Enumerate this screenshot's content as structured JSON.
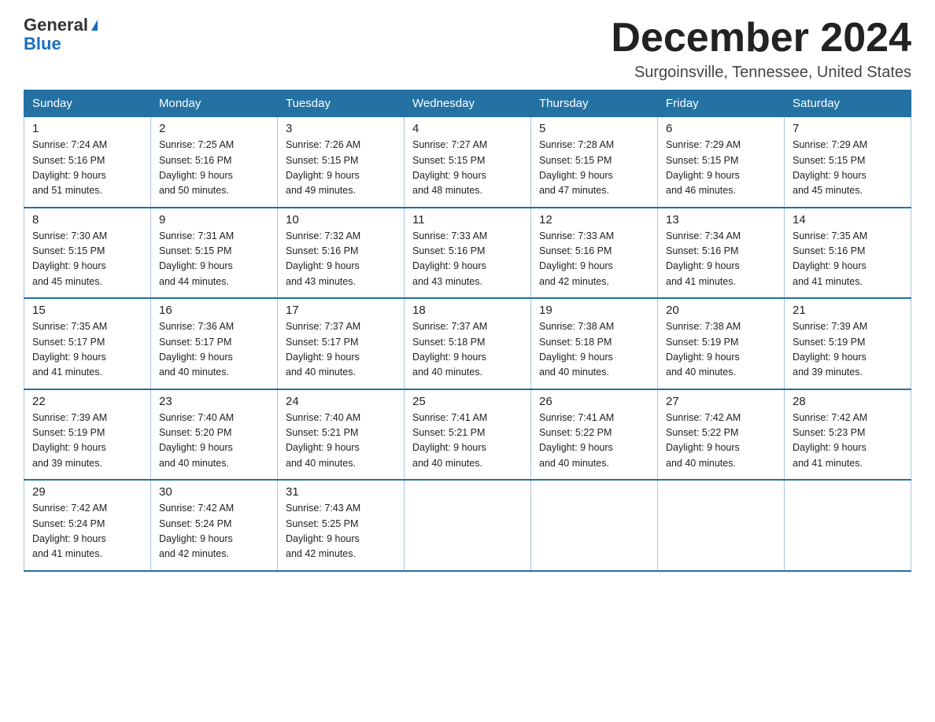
{
  "header": {
    "logo_general": "General",
    "logo_blue": "Blue",
    "month": "December 2024",
    "location": "Surgoinsville, Tennessee, United States"
  },
  "days_of_week": [
    "Sunday",
    "Monday",
    "Tuesday",
    "Wednesday",
    "Thursday",
    "Friday",
    "Saturday"
  ],
  "weeks": [
    [
      {
        "day": "1",
        "sunrise": "7:24 AM",
        "sunset": "5:16 PM",
        "daylight": "9 hours and 51 minutes."
      },
      {
        "day": "2",
        "sunrise": "7:25 AM",
        "sunset": "5:16 PM",
        "daylight": "9 hours and 50 minutes."
      },
      {
        "day": "3",
        "sunrise": "7:26 AM",
        "sunset": "5:15 PM",
        "daylight": "9 hours and 49 minutes."
      },
      {
        "day": "4",
        "sunrise": "7:27 AM",
        "sunset": "5:15 PM",
        "daylight": "9 hours and 48 minutes."
      },
      {
        "day": "5",
        "sunrise": "7:28 AM",
        "sunset": "5:15 PM",
        "daylight": "9 hours and 47 minutes."
      },
      {
        "day": "6",
        "sunrise": "7:29 AM",
        "sunset": "5:15 PM",
        "daylight": "9 hours and 46 minutes."
      },
      {
        "day": "7",
        "sunrise": "7:29 AM",
        "sunset": "5:15 PM",
        "daylight": "9 hours and 45 minutes."
      }
    ],
    [
      {
        "day": "8",
        "sunrise": "7:30 AM",
        "sunset": "5:15 PM",
        "daylight": "9 hours and 45 minutes."
      },
      {
        "day": "9",
        "sunrise": "7:31 AM",
        "sunset": "5:15 PM",
        "daylight": "9 hours and 44 minutes."
      },
      {
        "day": "10",
        "sunrise": "7:32 AM",
        "sunset": "5:16 PM",
        "daylight": "9 hours and 43 minutes."
      },
      {
        "day": "11",
        "sunrise": "7:33 AM",
        "sunset": "5:16 PM",
        "daylight": "9 hours and 43 minutes."
      },
      {
        "day": "12",
        "sunrise": "7:33 AM",
        "sunset": "5:16 PM",
        "daylight": "9 hours and 42 minutes."
      },
      {
        "day": "13",
        "sunrise": "7:34 AM",
        "sunset": "5:16 PM",
        "daylight": "9 hours and 41 minutes."
      },
      {
        "day": "14",
        "sunrise": "7:35 AM",
        "sunset": "5:16 PM",
        "daylight": "9 hours and 41 minutes."
      }
    ],
    [
      {
        "day": "15",
        "sunrise": "7:35 AM",
        "sunset": "5:17 PM",
        "daylight": "9 hours and 41 minutes."
      },
      {
        "day": "16",
        "sunrise": "7:36 AM",
        "sunset": "5:17 PM",
        "daylight": "9 hours and 40 minutes."
      },
      {
        "day": "17",
        "sunrise": "7:37 AM",
        "sunset": "5:17 PM",
        "daylight": "9 hours and 40 minutes."
      },
      {
        "day": "18",
        "sunrise": "7:37 AM",
        "sunset": "5:18 PM",
        "daylight": "9 hours and 40 minutes."
      },
      {
        "day": "19",
        "sunrise": "7:38 AM",
        "sunset": "5:18 PM",
        "daylight": "9 hours and 40 minutes."
      },
      {
        "day": "20",
        "sunrise": "7:38 AM",
        "sunset": "5:19 PM",
        "daylight": "9 hours and 40 minutes."
      },
      {
        "day": "21",
        "sunrise": "7:39 AM",
        "sunset": "5:19 PM",
        "daylight": "9 hours and 39 minutes."
      }
    ],
    [
      {
        "day": "22",
        "sunrise": "7:39 AM",
        "sunset": "5:19 PM",
        "daylight": "9 hours and 39 minutes."
      },
      {
        "day": "23",
        "sunrise": "7:40 AM",
        "sunset": "5:20 PM",
        "daylight": "9 hours and 40 minutes."
      },
      {
        "day": "24",
        "sunrise": "7:40 AM",
        "sunset": "5:21 PM",
        "daylight": "9 hours and 40 minutes."
      },
      {
        "day": "25",
        "sunrise": "7:41 AM",
        "sunset": "5:21 PM",
        "daylight": "9 hours and 40 minutes."
      },
      {
        "day": "26",
        "sunrise": "7:41 AM",
        "sunset": "5:22 PM",
        "daylight": "9 hours and 40 minutes."
      },
      {
        "day": "27",
        "sunrise": "7:42 AM",
        "sunset": "5:22 PM",
        "daylight": "9 hours and 40 minutes."
      },
      {
        "day": "28",
        "sunrise": "7:42 AM",
        "sunset": "5:23 PM",
        "daylight": "9 hours and 41 minutes."
      }
    ],
    [
      {
        "day": "29",
        "sunrise": "7:42 AM",
        "sunset": "5:24 PM",
        "daylight": "9 hours and 41 minutes."
      },
      {
        "day": "30",
        "sunrise": "7:42 AM",
        "sunset": "5:24 PM",
        "daylight": "9 hours and 42 minutes."
      },
      {
        "day": "31",
        "sunrise": "7:43 AM",
        "sunset": "5:25 PM",
        "daylight": "9 hours and 42 minutes."
      },
      null,
      null,
      null,
      null
    ]
  ],
  "labels": {
    "sunrise": "Sunrise:",
    "sunset": "Sunset:",
    "daylight": "Daylight:"
  }
}
